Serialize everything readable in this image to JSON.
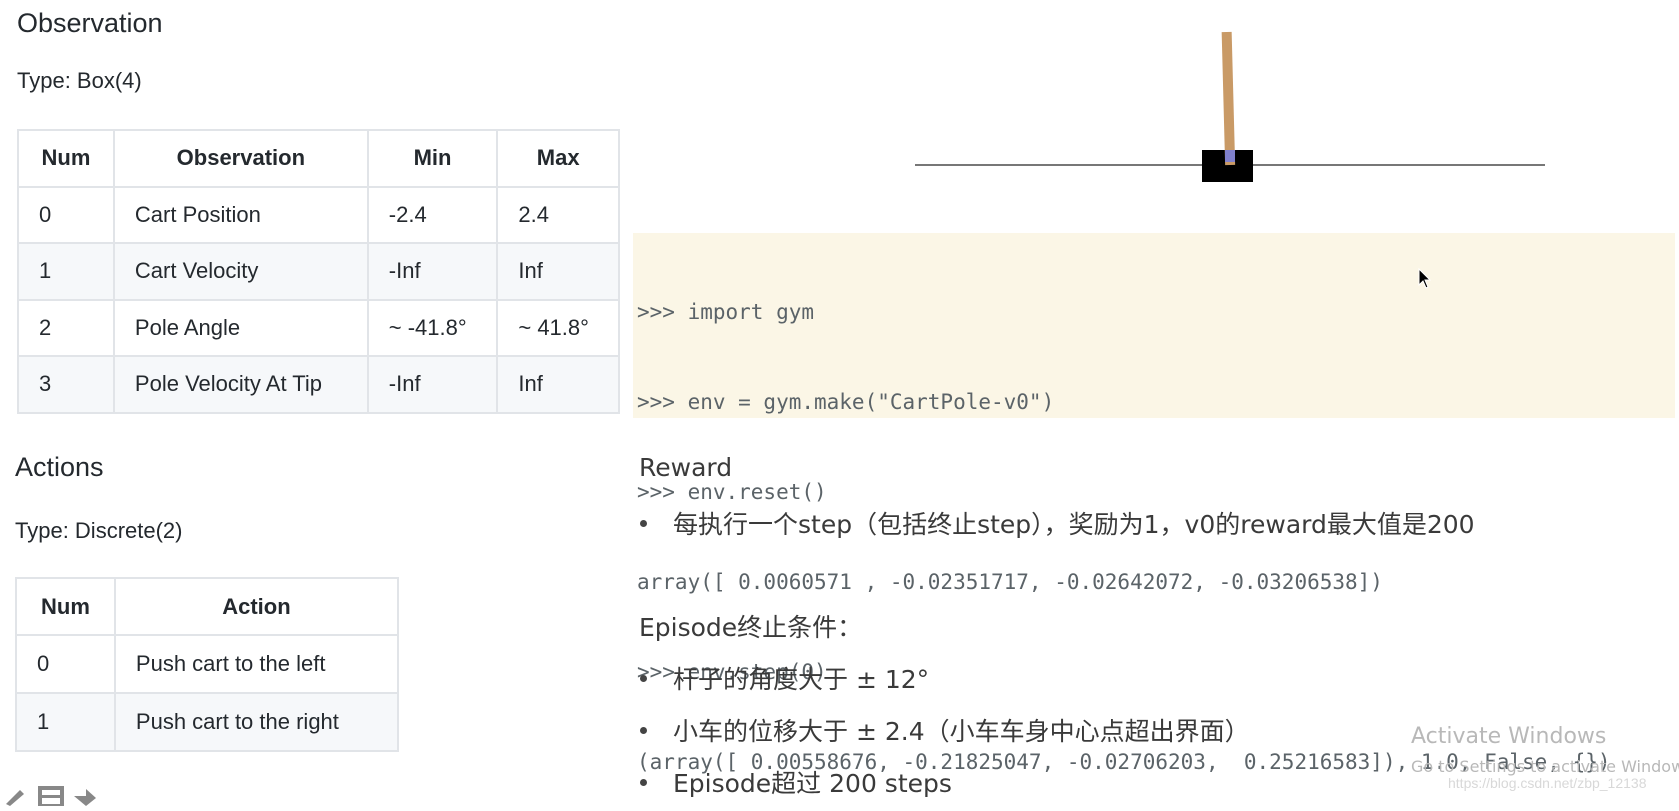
{
  "observation": {
    "heading": "Observation",
    "type_line": "Type: Box(4)",
    "table": {
      "headers": [
        "Num",
        "Observation",
        "Min",
        "Max"
      ],
      "rows": [
        [
          "0",
          "Cart Position",
          "-2.4",
          "2.4"
        ],
        [
          "1",
          "Cart Velocity",
          "-Inf",
          "Inf"
        ],
        [
          "2",
          "Pole Angle",
          "~ -41.8°",
          "~ 41.8°"
        ],
        [
          "3",
          "Pole Velocity At Tip",
          "-Inf",
          "Inf"
        ]
      ]
    }
  },
  "actions": {
    "heading": "Actions",
    "type_line": "Type: Discrete(2)",
    "table": {
      "headers": [
        "Num",
        "Action"
      ],
      "rows": [
        [
          "0",
          "Push cart to the left"
        ],
        [
          "1",
          "Push cart to the right"
        ]
      ]
    }
  },
  "cartpole_render": {
    "pole_color": "#c99a66",
    "cart_color": "#000000",
    "axle_color": "#8080cc",
    "track_color": "#777777",
    "pole_angle_deg": -1.5
  },
  "code": {
    "lines": [
      ">>> import gym",
      ">>> env = gym.make(\"CartPole-v0\")",
      ">>> env.reset()",
      "array([ 0.0060571 , -0.02351717, -0.02642072, -0.03206538])",
      ">>> env.step(0)",
      "(array([ 0.00558676, -0.21825047, -0.02706203,  0.25216583]), 1.0, False, {})"
    ]
  },
  "reward": {
    "heading": "Reward",
    "bullets": [
      "每执行一个step（包括终止step），奖励为1，v0的reward最大值是200"
    ]
  },
  "episode": {
    "heading": "Episode终止条件：",
    "bullets": [
      "杆子的角度大于 ± 12°",
      "小车的位移大于 ± 2.4（小车车身中心点超出界面）",
      "Episode超过 200 steps"
    ]
  },
  "watermark": {
    "title": "Activate Windows",
    "subtitle": "Go to Settings to activate Windows.",
    "url": "https://blog.csdn.net/zbp_12138"
  },
  "toolbar": {
    "icons": [
      "pencil-icon",
      "screen-icon",
      "share-arrow-icon"
    ]
  }
}
